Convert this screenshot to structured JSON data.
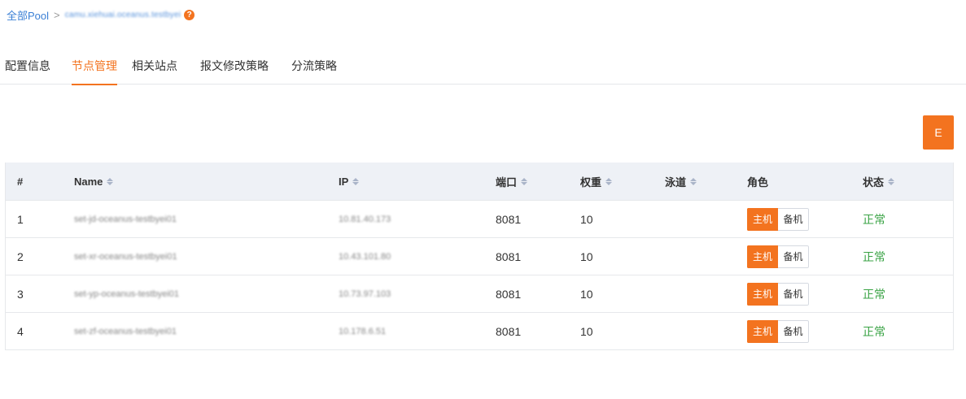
{
  "breadcrumb": {
    "root": "全部Pool",
    "separator": ">",
    "current": "camu.xiehuai.oceanus.testbyei"
  },
  "tabs": [
    {
      "label": "配置信息"
    },
    {
      "label": "节点管理"
    },
    {
      "label": "相关站点"
    },
    {
      "label": "报文修改策略"
    },
    {
      "label": "分流策略"
    }
  ],
  "active_tab": "节点管理",
  "actions": {
    "e_label": "E"
  },
  "table": {
    "columns": [
      "#",
      "Name",
      "IP",
      "端口",
      "权重",
      "泳道",
      "角色",
      "状态"
    ],
    "rows": [
      {
        "idx": "1",
        "name": "set-jd-oceanus-testbyei01",
        "ip": "10.81.40.173",
        "port": "8081",
        "weight": "10",
        "lane": "",
        "role_primary": "主机",
        "role_backup": "备机",
        "status": "正常"
      },
      {
        "idx": "2",
        "name": "set-xr-oceanus-testbyei01",
        "ip": "10.43.101.80",
        "port": "8081",
        "weight": "10",
        "lane": "",
        "role_primary": "主机",
        "role_backup": "备机",
        "status": "正常"
      },
      {
        "idx": "3",
        "name": "set-yp-oceanus-testbyei01",
        "ip": "10.73.97.103",
        "port": "8081",
        "weight": "10",
        "lane": "",
        "role_primary": "主机",
        "role_backup": "备机",
        "status": "正常"
      },
      {
        "idx": "4",
        "name": "set-zf-oceanus-testbyei01",
        "ip": "10.178.6.51",
        "port": "8081",
        "weight": "10",
        "lane": "",
        "role_primary": "主机",
        "role_backup": "备机",
        "status": "正常"
      }
    ]
  },
  "colors": {
    "accent": "#f3731f",
    "link": "#3a7fd5",
    "status_ok": "#3aa345",
    "header_bg": "#eef1f6"
  }
}
